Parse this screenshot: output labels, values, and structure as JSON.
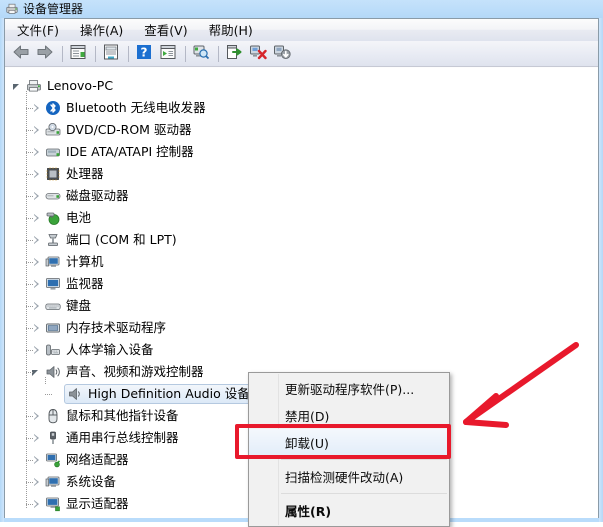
{
  "window": {
    "title": "设备管理器",
    "icon": "device-manager-icon"
  },
  "menubar": {
    "items": [
      {
        "label": "文件(F)",
        "name": "menu-file"
      },
      {
        "label": "操作(A)",
        "name": "menu-action"
      },
      {
        "label": "查看(V)",
        "name": "menu-view"
      },
      {
        "label": "帮助(H)",
        "name": "menu-help"
      }
    ]
  },
  "toolbar": {
    "buttons": [
      {
        "icon": "back-arrow-icon",
        "name": "toolbar-back"
      },
      {
        "icon": "forward-arrow-icon",
        "name": "toolbar-forward"
      },
      {
        "sep": true
      },
      {
        "icon": "show-hide-console-tree-icon",
        "name": "toolbar-console-tree"
      },
      {
        "sep": true
      },
      {
        "icon": "properties-icon",
        "name": "toolbar-properties"
      },
      {
        "sep": true
      },
      {
        "icon": "help-icon",
        "name": "toolbar-help"
      },
      {
        "icon": "show-hide-action-pane-icon",
        "name": "toolbar-action-pane"
      },
      {
        "sep": true
      },
      {
        "icon": "scan-hardware-changes-icon",
        "name": "toolbar-scan-hardware"
      },
      {
        "sep": true
      },
      {
        "icon": "update-driver-icon",
        "name": "toolbar-update-driver"
      },
      {
        "icon": "uninstall-device-icon",
        "name": "toolbar-uninstall-device"
      },
      {
        "icon": "disable-device-icon",
        "name": "toolbar-disable-device"
      }
    ]
  },
  "tree": {
    "nodes": [
      {
        "label": "Lenovo-PC",
        "level": 0,
        "state": "expanded",
        "icon": "computer-root-icon",
        "selected": false
      },
      {
        "label": "Bluetooth 无线电收发器",
        "level": 1,
        "state": "collapsed",
        "icon": "bluetooth-icon",
        "selected": false
      },
      {
        "label": "DVD/CD-ROM 驱动器",
        "level": 1,
        "state": "collapsed",
        "icon": "dvd-drive-icon",
        "selected": false
      },
      {
        "label": "IDE ATA/ATAPI 控制器",
        "level": 1,
        "state": "collapsed",
        "icon": "ide-controller-icon",
        "selected": false
      },
      {
        "label": "处理器",
        "level": 1,
        "state": "collapsed",
        "icon": "processor-icon",
        "selected": false
      },
      {
        "label": "磁盘驱动器",
        "level": 1,
        "state": "collapsed",
        "icon": "disk-drive-icon",
        "selected": false
      },
      {
        "label": "电池",
        "level": 1,
        "state": "collapsed",
        "icon": "battery-icon",
        "selected": false
      },
      {
        "label": "端口 (COM 和 LPT)",
        "level": 1,
        "state": "collapsed",
        "icon": "ports-icon",
        "selected": false
      },
      {
        "label": "计算机",
        "level": 1,
        "state": "collapsed",
        "icon": "computer-icon",
        "selected": false
      },
      {
        "label": "监视器",
        "level": 1,
        "state": "collapsed",
        "icon": "monitor-icon",
        "selected": false
      },
      {
        "label": "键盘",
        "level": 1,
        "state": "collapsed",
        "icon": "keyboard-icon",
        "selected": false
      },
      {
        "label": "内存技术驱动程序",
        "level": 1,
        "state": "collapsed",
        "icon": "memory-technology-icon",
        "selected": false
      },
      {
        "label": "人体学输入设备",
        "level": 1,
        "state": "collapsed",
        "icon": "hid-icon",
        "selected": false
      },
      {
        "label": "声音、视频和游戏控制器",
        "level": 1,
        "state": "expanded",
        "icon": "sound-controller-icon",
        "selected": false
      },
      {
        "label": "High Definition Audio 设备",
        "level": 2,
        "state": "leaf",
        "icon": "audio-device-icon",
        "selected": true
      },
      {
        "label": "鼠标和其他指针设备",
        "level": 1,
        "state": "collapsed",
        "icon": "mouse-icon",
        "selected": false
      },
      {
        "label": "通用串行总线控制器",
        "level": 1,
        "state": "collapsed",
        "icon": "usb-controller-icon",
        "selected": false
      },
      {
        "label": "网络适配器",
        "level": 1,
        "state": "collapsed",
        "icon": "network-adapter-icon",
        "selected": false
      },
      {
        "label": "系统设备",
        "level": 1,
        "state": "collapsed",
        "icon": "system-device-icon",
        "selected": false
      },
      {
        "label": "显示适配器",
        "level": 1,
        "state": "collapsed",
        "icon": "display-adapter-icon",
        "selected": false
      }
    ]
  },
  "context_menu": {
    "items": [
      {
        "label": "更新驱动程序软件(P)...",
        "name": "ctx-update-driver",
        "bold": false,
        "highlighted": false,
        "separator_after": false
      },
      {
        "label": "禁用(D)",
        "name": "ctx-disable",
        "bold": false,
        "highlighted": false,
        "separator_after": false
      },
      {
        "label": "卸载(U)",
        "name": "ctx-uninstall",
        "bold": false,
        "highlighted": true,
        "separator_after": true
      },
      {
        "label": "扫描检测硬件改动(A)",
        "name": "ctx-scan-hardware",
        "bold": false,
        "highlighted": false,
        "separator_after": true
      },
      {
        "label": "属性(R)",
        "name": "ctx-properties",
        "bold": true,
        "highlighted": false,
        "separator_after": false
      }
    ]
  },
  "annotation": {
    "highlight_color": "#e8192c",
    "arrow_color": "#e8192c",
    "target_item": "卸载(U)"
  }
}
